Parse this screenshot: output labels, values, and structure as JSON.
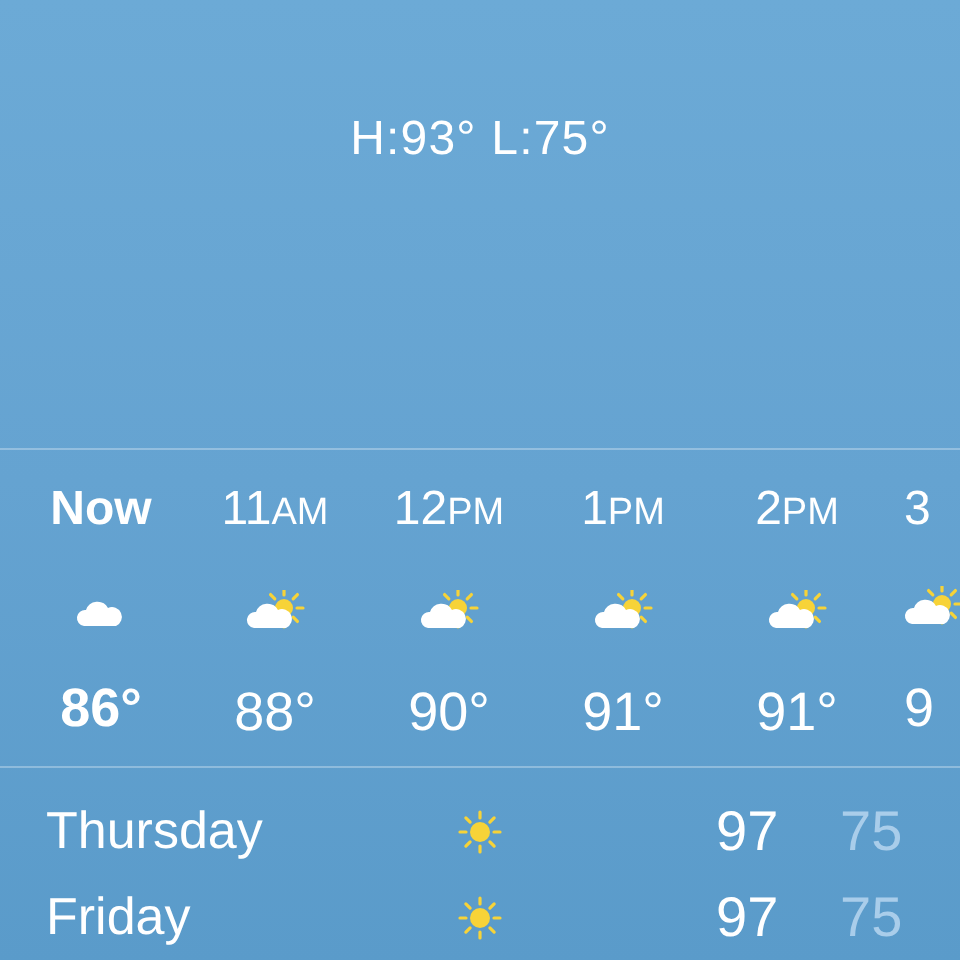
{
  "current": {
    "high_low": "H:93° L:75°"
  },
  "hourly": [
    {
      "hour": "Now",
      "now": true,
      "kind": "cloudy",
      "temp": "86°"
    },
    {
      "hour": "11",
      "period": "AM",
      "now": false,
      "kind": "partly_sunny",
      "temp": "88°"
    },
    {
      "hour": "12",
      "period": "PM",
      "now": false,
      "kind": "partly_sunny",
      "temp": "90°"
    },
    {
      "hour": "1",
      "period": "PM",
      "now": false,
      "kind": "partly_sunny",
      "temp": "91°"
    },
    {
      "hour": "2",
      "period": "PM",
      "now": false,
      "kind": "partly_sunny",
      "temp": "91°"
    },
    {
      "hour": "3",
      "now": false,
      "kind": "partly_sunny",
      "temp": "9"
    }
  ],
  "daily": [
    {
      "day": "Thursday",
      "kind": "sunny",
      "high": "97",
      "low": "75"
    },
    {
      "day": "Friday",
      "kind": "sunny",
      "high": "97",
      "low": "75"
    }
  ]
}
